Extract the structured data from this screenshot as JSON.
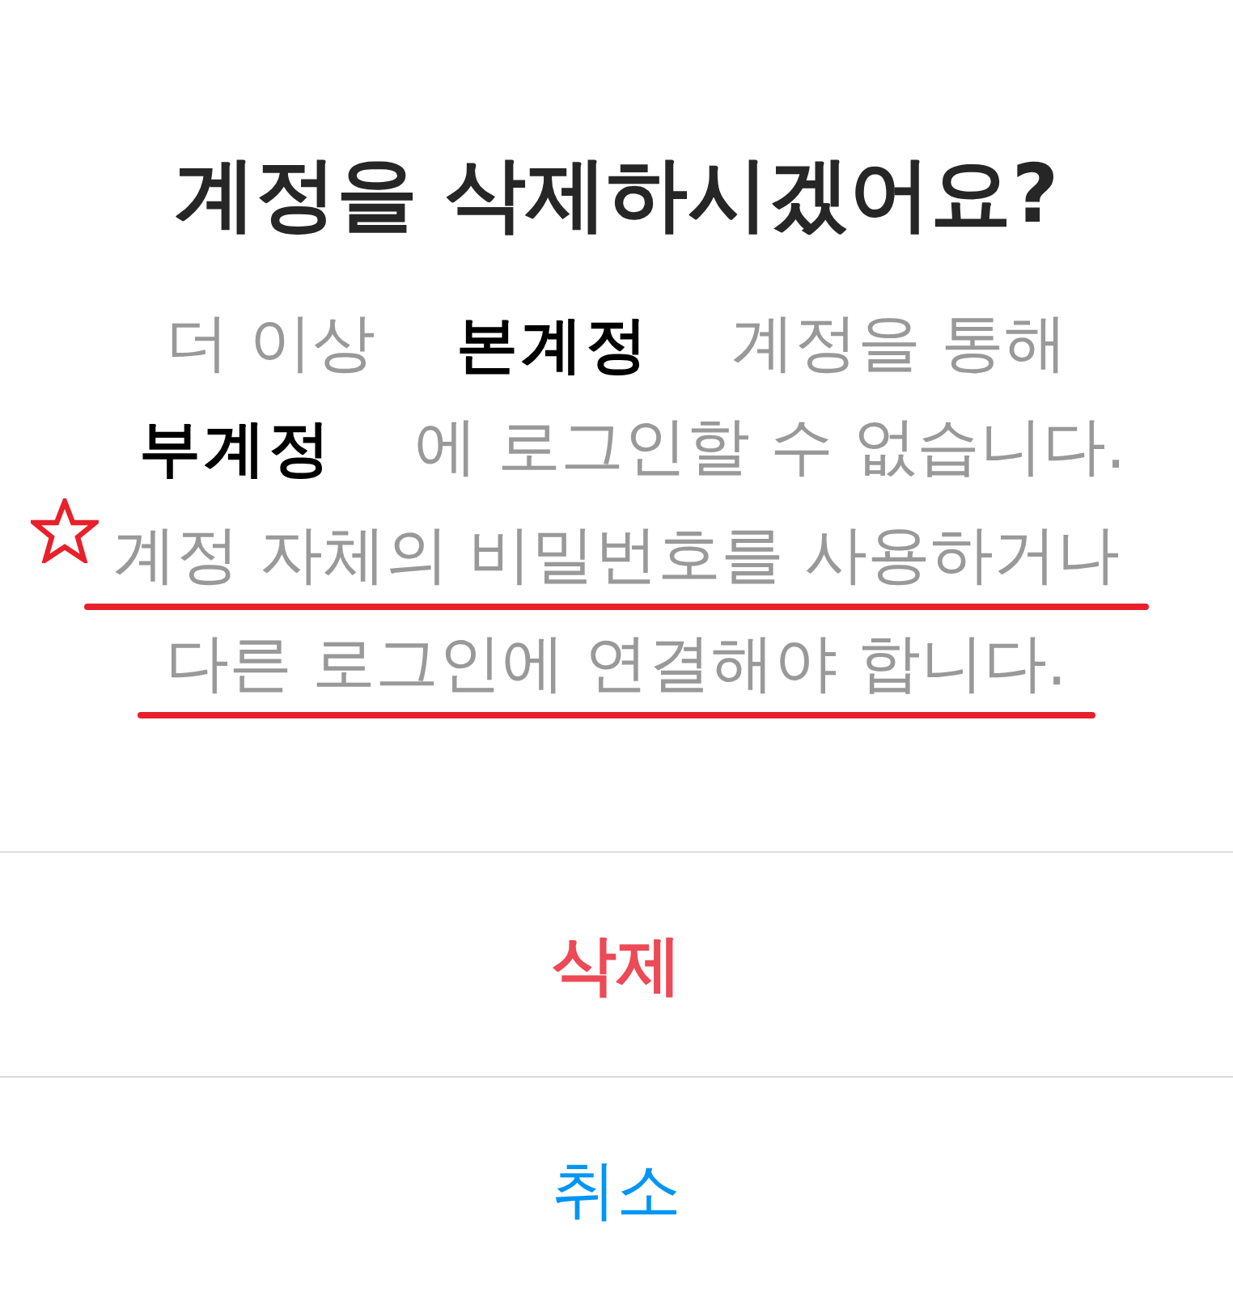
{
  "dialog": {
    "title": "계정을 삭제하시겠어요?",
    "message": [
      {
        "starred": false,
        "underlined": false,
        "segments": [
          {
            "kind": "text",
            "text": "더 이상"
          },
          {
            "kind": "handwriting",
            "text": "본계정"
          },
          {
            "kind": "text",
            "text": "계정을 통해"
          }
        ]
      },
      {
        "starred": false,
        "underlined": false,
        "segments": [
          {
            "kind": "handwriting",
            "text": "부계정"
          },
          {
            "kind": "text",
            "text": "에 로그인할 수 없습니다."
          }
        ]
      },
      {
        "starred": true,
        "underlined": true,
        "segments": [
          {
            "kind": "text",
            "text": "계정 자체의 비밀번호를 사용하거나"
          }
        ]
      },
      {
        "starred": false,
        "underlined": true,
        "segments": [
          {
            "kind": "text",
            "text": "다른 로그인에 연결해야 합니다."
          }
        ]
      }
    ],
    "actions": [
      {
        "kind": "destructive",
        "label": "삭제"
      },
      {
        "kind": "cancel",
        "label": "취소"
      }
    ]
  }
}
